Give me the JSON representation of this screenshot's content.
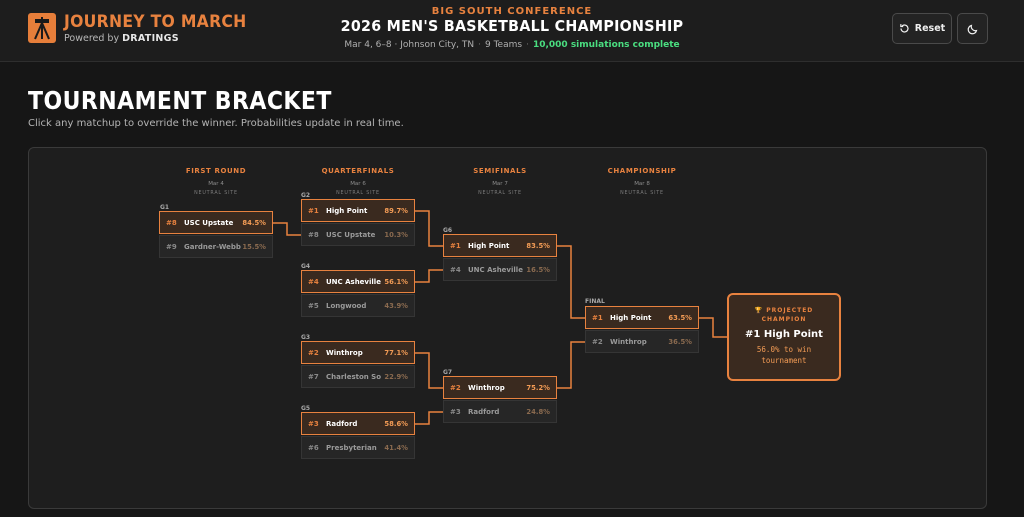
{
  "header": {
    "brand_title": "JOURNEY TO MARCH",
    "powered_by": "Powered by",
    "brand_name": "DRATINGS",
    "conference": "BIG SOUTH CONFERENCE",
    "championship_title": "2026 MEN'S BASKETBALL CHAMPIONSHIP",
    "meta_dates": "Mar 4, 6–8 · Johnson City, TN",
    "meta_teams": "9 Teams",
    "meta_status": "10,000 simulations complete",
    "reset_label": "Reset",
    "icons": {
      "reset": "reset-icon",
      "theme": "moon-icon",
      "logo": "easel-logo-icon"
    }
  },
  "page": {
    "heading": "TOURNAMENT BRACKET",
    "description": "Click any matchup to override the winner. Probabilities update in real time."
  },
  "rounds": [
    {
      "name": "FIRST ROUND",
      "date": "Mar 4",
      "site": "NEUTRAL SITE"
    },
    {
      "name": "QUARTERFINALS",
      "date": "Mar 6",
      "site": "NEUTRAL SITE"
    },
    {
      "name": "SEMIFINALS",
      "date": "Mar 7",
      "site": "NEUTRAL SITE"
    },
    {
      "name": "CHAMPIONSHIP",
      "date": "Mar 8",
      "site": "NEUTRAL SITE"
    }
  ],
  "games": {
    "g1": {
      "label": "G1",
      "teams": [
        {
          "seed": "#8",
          "name": "USC Upstate",
          "pct": "84.5%"
        },
        {
          "seed": "#9",
          "name": "Gardner-Webb",
          "pct": "15.5%"
        }
      ]
    },
    "g2": {
      "label": "G2",
      "teams": [
        {
          "seed": "#1",
          "name": "High Point",
          "pct": "89.7%"
        },
        {
          "seed": "#8",
          "name": "USC Upstate",
          "pct": "10.3%"
        }
      ]
    },
    "g4": {
      "label": "G4",
      "teams": [
        {
          "seed": "#4",
          "name": "UNC Asheville",
          "pct": "56.1%"
        },
        {
          "seed": "#5",
          "name": "Longwood",
          "pct": "43.9%"
        }
      ]
    },
    "g3": {
      "label": "G3",
      "teams": [
        {
          "seed": "#2",
          "name": "Winthrop",
          "pct": "77.1%"
        },
        {
          "seed": "#7",
          "name": "Charleston So",
          "pct": "22.9%"
        }
      ]
    },
    "g5": {
      "label": "G5",
      "teams": [
        {
          "seed": "#3",
          "name": "Radford",
          "pct": "58.6%"
        },
        {
          "seed": "#6",
          "name": "Presbyterian",
          "pct": "41.4%"
        }
      ]
    },
    "g6": {
      "label": "G6",
      "teams": [
        {
          "seed": "#1",
          "name": "High Point",
          "pct": "83.5%"
        },
        {
          "seed": "#4",
          "name": "UNC Asheville",
          "pct": "16.5%"
        }
      ]
    },
    "g7": {
      "label": "G7",
      "teams": [
        {
          "seed": "#2",
          "name": "Winthrop",
          "pct": "75.2%"
        },
        {
          "seed": "#3",
          "name": "Radford",
          "pct": "24.8%"
        }
      ]
    },
    "final": {
      "label": "FINAL",
      "teams": [
        {
          "seed": "#1",
          "name": "High Point",
          "pct": "63.5%"
        },
        {
          "seed": "#2",
          "name": "Winthrop",
          "pct": "36.5%"
        }
      ]
    }
  },
  "projected": {
    "label_line1": "PROJECTED",
    "label_line2": "CHAMPION",
    "team": "#1 High Point",
    "sub_line1": "56.0% to win",
    "sub_line2": "tournament",
    "icon": "trophy-icon"
  },
  "colors": {
    "accent": "#e8823f",
    "success": "#4ade80",
    "background": "#161616",
    "panel": "#1e1e1e"
  }
}
